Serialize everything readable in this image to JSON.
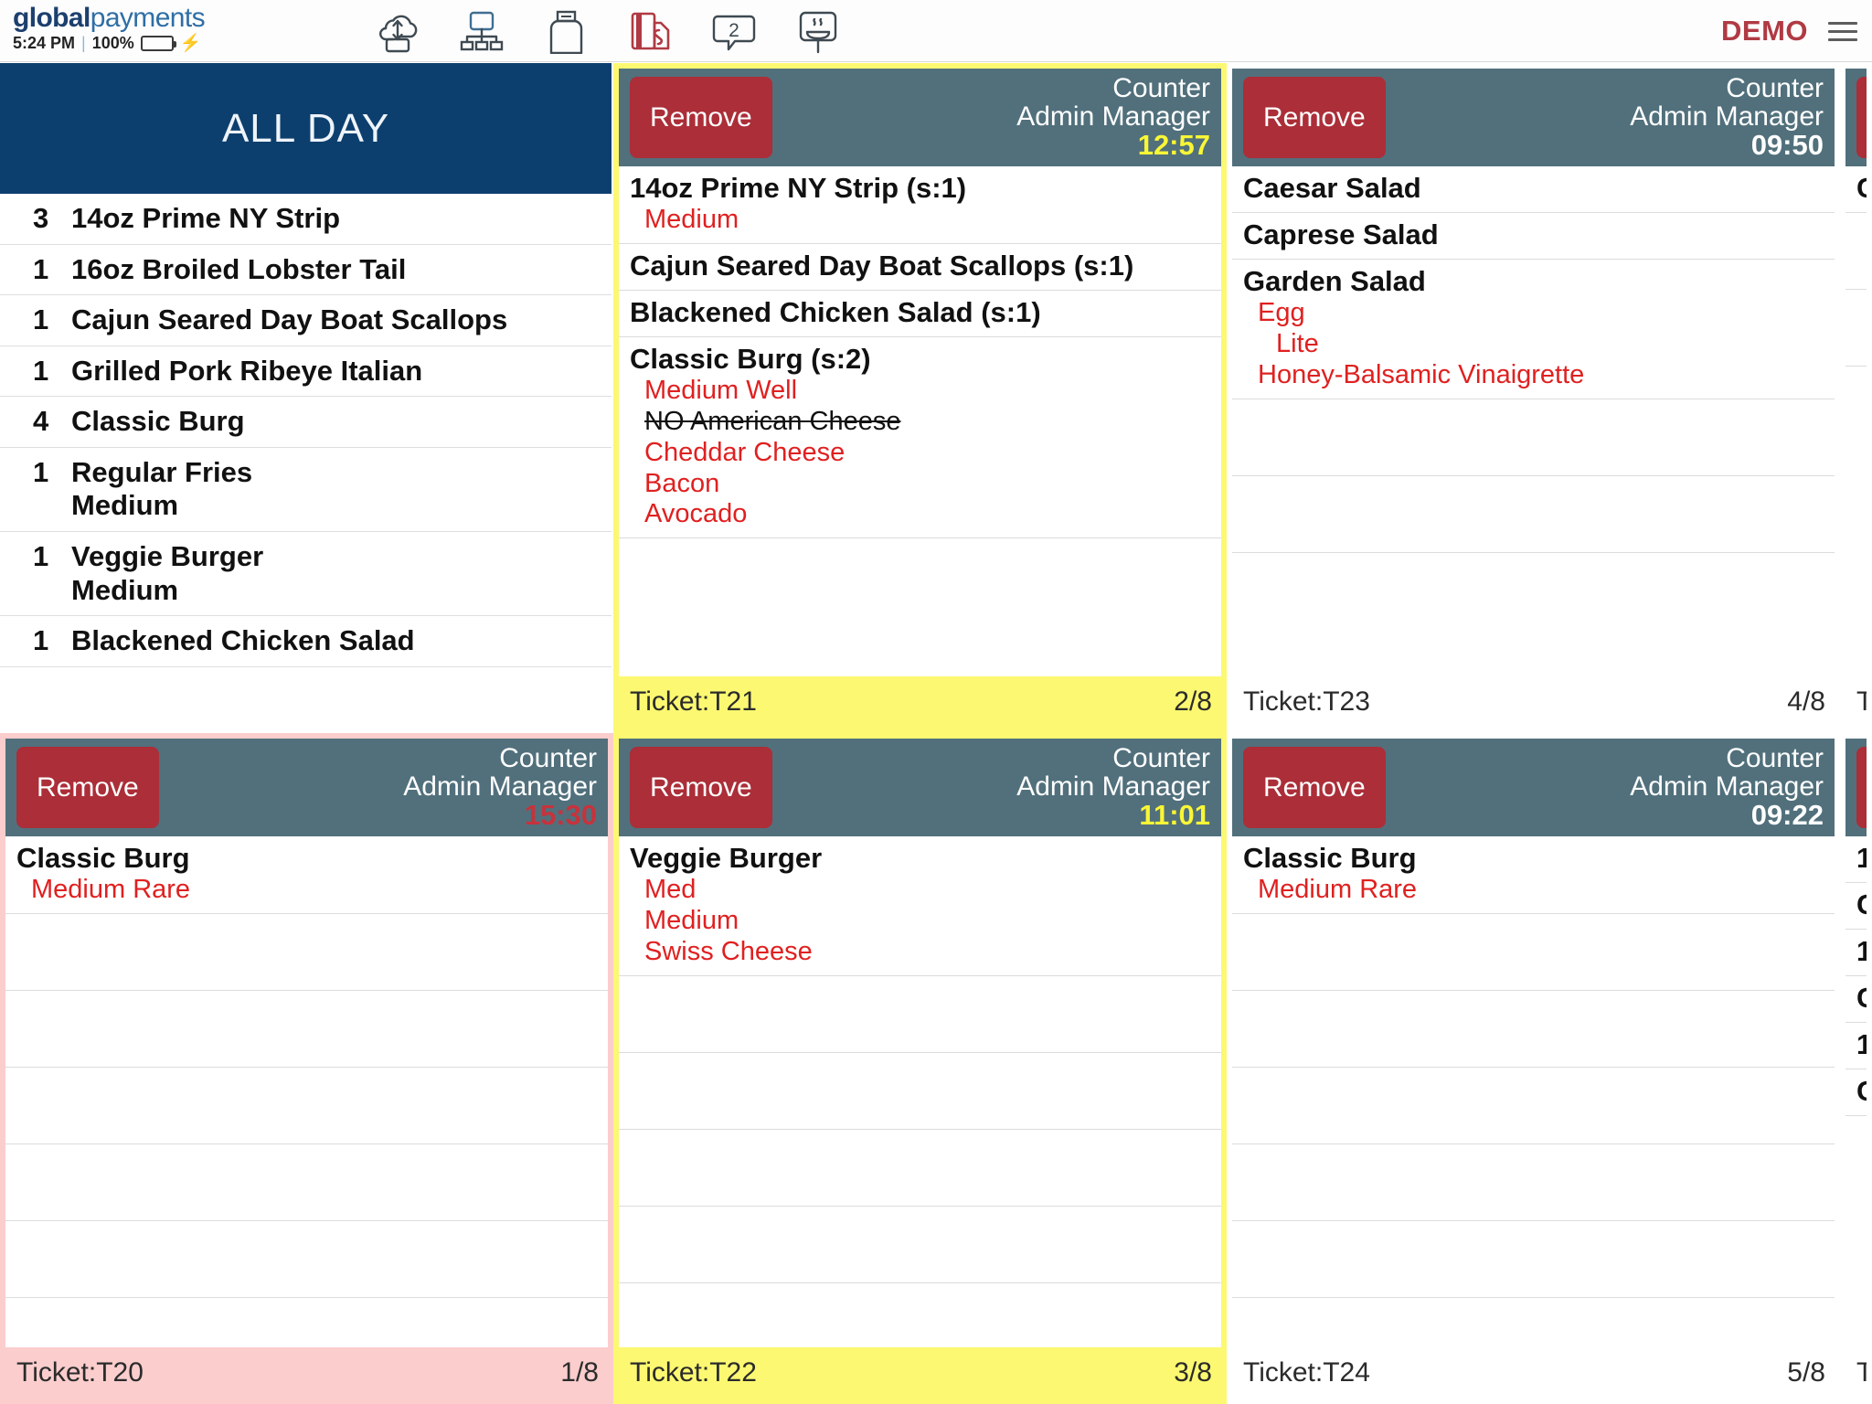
{
  "topbar": {
    "brand_bold": "global",
    "brand_light": "payments",
    "time": "5:24 PM",
    "separator": "|",
    "battery_percent": "100%",
    "charging_icon": "⚡",
    "icons": [
      {
        "name": "cloud-sync-icon",
        "title": "Cloud Sync"
      },
      {
        "name": "network-icon",
        "title": "Network"
      },
      {
        "name": "printer-icon",
        "title": "Printer"
      },
      {
        "name": "card-reader-icon",
        "title": "Card Reader"
      },
      {
        "name": "messages-icon",
        "title": "Messages",
        "badge": "2"
      },
      {
        "name": "hot-food-sign-icon",
        "title": "Kitchen Display"
      }
    ],
    "demo_label": "DEMO",
    "menu_icon": "hamburger-icon"
  },
  "allday": {
    "title": "ALL DAY",
    "items": [
      {
        "qty": "3",
        "name": "14oz Prime NY Strip",
        "mod": ""
      },
      {
        "qty": "1",
        "name": "16oz Broiled Lobster Tail",
        "mod": ""
      },
      {
        "qty": "1",
        "name": "Cajun Seared Day Boat Scallops",
        "mod": ""
      },
      {
        "qty": "1",
        "name": "Grilled Pork Ribeye Italian",
        "mod": ""
      },
      {
        "qty": "4",
        "name": "Classic Burg",
        "mod": ""
      },
      {
        "qty": "1",
        "name": "Regular Fries",
        "mod": "Medium"
      },
      {
        "qty": "1",
        "name": "Veggie Burger",
        "mod": "Medium"
      },
      {
        "qty": "1",
        "name": "Blackened Chicken Salad",
        "mod": ""
      }
    ]
  },
  "tickets": [
    {
      "id": "t21",
      "remove_label": "Remove",
      "source": "Counter",
      "user": "Admin Manager",
      "timer": "12:57",
      "timer_state": "warn",
      "highlight": "yellow",
      "ticket_label": "Ticket:T21",
      "position": "2/8",
      "items": [
        {
          "name": "14oz Prime NY Strip (s:1)",
          "mods": [
            {
              "text": "Medium",
              "style": "add",
              "indent": 0
            }
          ]
        },
        {
          "name": "Cajun Seared Day Boat Scallops (s:1)",
          "mods": []
        },
        {
          "name": "Blackened Chicken Salad (s:1)",
          "mods": []
        },
        {
          "name": "Classic Burg (s:2)",
          "mods": [
            {
              "text": "Medium Well",
              "style": "add",
              "indent": 0
            },
            {
              "text": "NO American Cheese",
              "style": "removed",
              "indent": 0
            },
            {
              "text": "Cheddar Cheese",
              "style": "add",
              "indent": 0
            },
            {
              "text": "Bacon",
              "style": "add",
              "indent": 0
            },
            {
              "text": "Avocado",
              "style": "add",
              "indent": 0
            }
          ]
        }
      ],
      "spacers": 0
    },
    {
      "id": "t23",
      "remove_label": "Remove",
      "source": "Counter",
      "user": "Admin Manager",
      "timer": "09:50",
      "timer_state": "ok",
      "highlight": "none",
      "ticket_label": "Ticket:T23",
      "position": "4/8",
      "items": [
        {
          "name": "Caesar Salad",
          "mods": []
        },
        {
          "name": "Caprese Salad",
          "mods": []
        },
        {
          "name": "Garden Salad",
          "mods": [
            {
              "text": "Egg",
              "style": "add",
              "indent": 0
            },
            {
              "text": "Lite",
              "style": "add",
              "indent": 1
            },
            {
              "text": "Honey-Balsamic Vinaigrette",
              "style": "add",
              "indent": 0
            }
          ]
        }
      ],
      "spacers": 2
    },
    {
      "id": "t20",
      "remove_label": "Remove",
      "source": "Counter",
      "user": "Admin Manager",
      "timer": "15:30",
      "timer_state": "late",
      "highlight": "pink",
      "ticket_label": "Ticket:T20",
      "position": "1/8",
      "items": [
        {
          "name": "Classic Burg",
          "mods": [
            {
              "text": "Medium Rare",
              "style": "add",
              "indent": 0
            }
          ]
        }
      ],
      "spacers": 5
    },
    {
      "id": "t22",
      "remove_label": "Remove",
      "source": "Counter",
      "user": "Admin Manager",
      "timer": "11:01",
      "timer_state": "warn",
      "highlight": "yellow",
      "ticket_label": "Ticket:T22",
      "position": "3/8",
      "items": [
        {
          "name": "Veggie Burger",
          "mods": [
            {
              "text": "Med",
              "style": "add",
              "indent": 0
            },
            {
              "text": "Medium",
              "style": "add",
              "indent": 0
            },
            {
              "text": "Swiss Cheese",
              "style": "add",
              "indent": 0
            }
          ]
        }
      ],
      "spacers": 4
    },
    {
      "id": "t24",
      "remove_label": "Remove",
      "source": "Counter",
      "user": "Admin Manager",
      "timer": "09:22",
      "timer_state": "ok",
      "highlight": "none",
      "ticket_label": "Ticket:T24",
      "position": "5/8",
      "items": [
        {
          "name": "Classic Burg",
          "mods": [
            {
              "text": "Medium Rare",
              "style": "add",
              "indent": 0
            }
          ]
        }
      ],
      "spacers": 5
    }
  ],
  "clipped_column": {
    "top_ticket_first_letter": "C",
    "bottom_ticket_lines": [
      "1",
      "C",
      "1",
      "C",
      "1",
      "G"
    ]
  },
  "colors": {
    "header_blue": "#0d3f6e",
    "ticket_header_slate": "#51707c",
    "remove_red": "#ab2e38",
    "modifier_red": "#e02020",
    "highlight_yellow": "#fcf871",
    "highlight_pink": "#fbcdcd",
    "timer_yellow": "#f9f636",
    "timer_red": "#c6333c",
    "brand_navy": "#1c3f6e",
    "brand_blue": "#2f6ea5",
    "demo_red": "#b03a43",
    "battery_green": "#6cc12a"
  }
}
